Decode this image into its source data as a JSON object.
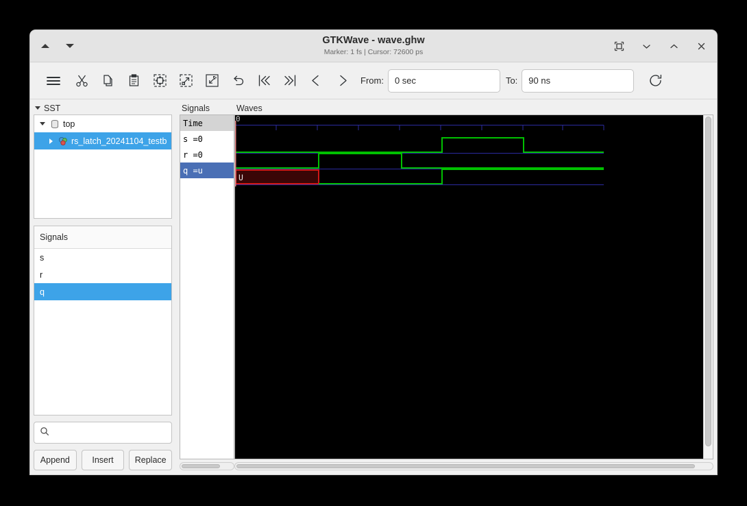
{
  "window": {
    "title": "GTKWave - wave.ghw",
    "subtitle": "Marker: 1 fs  |  Cursor: 72600 ps",
    "nav_prev_icon": "triangle-up-icon",
    "nav_next_icon": "triangle-down-icon",
    "controls": {
      "restore_icon": "restore-window-icon",
      "minimize_icon": "chevron-down-icon",
      "maximize_icon": "chevron-up-icon",
      "close_icon": "close-icon"
    }
  },
  "toolbar": {
    "items": [
      {
        "name": "menu-icon",
        "title": "Menu"
      },
      {
        "name": "cut-icon",
        "title": "Cut"
      },
      {
        "name": "copy-icon",
        "title": "Copy"
      },
      {
        "name": "paste-icon",
        "title": "Paste"
      },
      {
        "name": "zoom-fit-icon",
        "title": "Zoom Fit"
      },
      {
        "name": "zoom-in-icon",
        "title": "Zoom In"
      },
      {
        "name": "zoom-out-icon",
        "title": "Zoom Out"
      },
      {
        "name": "undo-icon",
        "title": "Undo"
      },
      {
        "name": "go-to-start-icon",
        "title": "Go To Start"
      },
      {
        "name": "go-to-end-icon",
        "title": "Go To End"
      },
      {
        "name": "step-back-icon",
        "title": "Previous Edge"
      },
      {
        "name": "step-forward-icon",
        "title": "Next Edge"
      }
    ],
    "from_label": "From:",
    "from_value": "0 sec",
    "to_label": "To:",
    "to_value": "90 ns",
    "reload_icon": "reload-icon"
  },
  "sidebar": {
    "sst": {
      "title": "SST",
      "tree": [
        {
          "label": "top",
          "icon": "module-icon",
          "twisty": "down",
          "selected": false,
          "depth": 0
        },
        {
          "label": "rs_latch_20241104_testb",
          "icon": "instance-icon",
          "twisty": "right",
          "selected": true,
          "depth": 1
        }
      ]
    },
    "signal_list": {
      "header": "Signals",
      "items": [
        {
          "label": "s",
          "selected": false
        },
        {
          "label": "r",
          "selected": false
        },
        {
          "label": "q",
          "selected": true
        }
      ]
    },
    "search": {
      "icon": "search-icon",
      "placeholder": "",
      "value": ""
    },
    "buttons": [
      {
        "label": "Append",
        "name": "append-button"
      },
      {
        "label": "Insert",
        "name": "insert-button"
      },
      {
        "label": "Replace",
        "name": "replace-button"
      }
    ]
  },
  "signal_names_pane": {
    "title": "Signals",
    "rows": [
      {
        "label": "Time",
        "type": "header",
        "selected": false
      },
      {
        "label": "s =0",
        "type": "signal",
        "selected": false
      },
      {
        "label": "r =0",
        "type": "signal",
        "selected": false
      },
      {
        "label": "q =u",
        "type": "signal",
        "selected": true
      }
    ]
  },
  "waves_pane": {
    "title": "Waves",
    "time_origin_label": "0"
  },
  "colors": {
    "wave_background": "#000000",
    "wave_high_low": "#00c000",
    "wave_grid": "#2b2ba0",
    "wave_undefined": "#d01818",
    "wave_undefined_fill": "#3a0606",
    "marker": "#e08080",
    "selection_blue": "#3da3e8",
    "name_selection_blue": "#4a6fb5"
  },
  "chart_data": {
    "type": "line",
    "title": "Waves",
    "xlabel": "Time",
    "ylabel": "",
    "xlim": [
      0,
      90
    ],
    "x_unit": "ns",
    "grid": true,
    "legend": "none",
    "tick_interval_ns": 10,
    "series": [
      {
        "name": "s",
        "value_label": "s =0",
        "current_value": "0",
        "transitions": [
          {
            "time_ns": 0,
            "value": "0"
          },
          {
            "time_ns": 55,
            "value": "1"
          },
          {
            "time_ns": 77,
            "value": "0"
          }
        ]
      },
      {
        "name": "r",
        "value_label": "r =0",
        "current_value": "0",
        "transitions": [
          {
            "time_ns": 0,
            "value": "0"
          },
          {
            "time_ns": 22,
            "value": "1"
          },
          {
            "time_ns": 44,
            "value": "0"
          }
        ]
      },
      {
        "name": "q",
        "value_label": "q =u",
        "current_value": "u",
        "transitions": [
          {
            "time_ns": 0,
            "value": "U"
          },
          {
            "time_ns": 22,
            "value": "0"
          },
          {
            "time_ns": 55,
            "value": "1"
          }
        ]
      }
    ],
    "undefined_label": "U",
    "marker_time_ns": 0
  }
}
